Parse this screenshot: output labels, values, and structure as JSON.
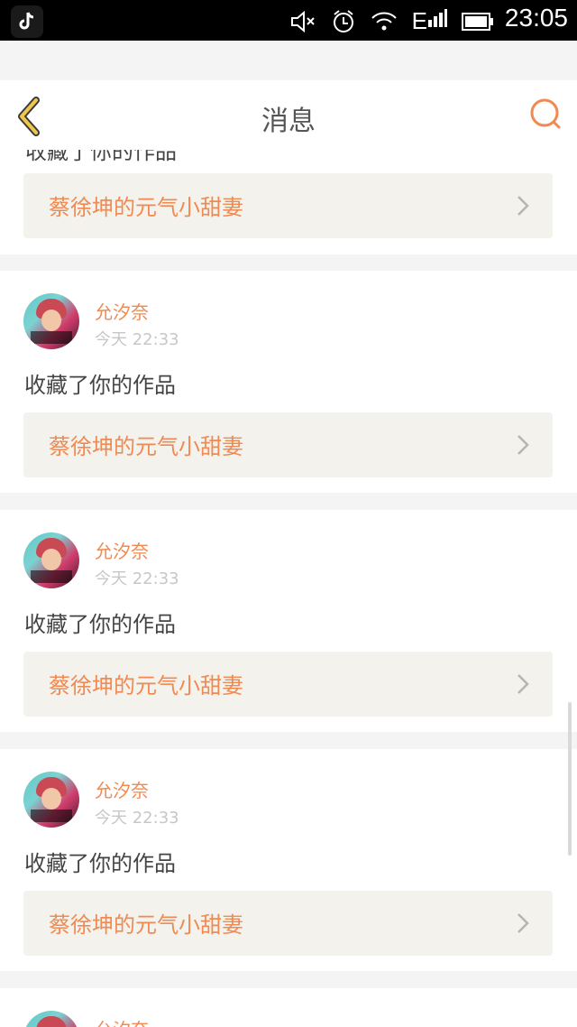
{
  "status_bar": {
    "time": "23:05",
    "network": "E"
  },
  "nav": {
    "title": "消息"
  },
  "partial_top": {
    "action_text_partial": "收藏了你的作品",
    "work_title": "蔡徐坤的元气小甜妻"
  },
  "notifications": [
    {
      "username": "允汐奈",
      "time": "今天 22:33",
      "action": "收藏了你的作品",
      "work_title": "蔡徐坤的元气小甜妻"
    },
    {
      "username": "允汐奈",
      "time": "今天 22:33",
      "action": "收藏了你的作品",
      "work_title": "蔡徐坤的元气小甜妻"
    },
    {
      "username": "允汐奈",
      "time": "今天 22:33",
      "action": "收藏了你的作品",
      "work_title": "蔡徐坤的元气小甜妻"
    }
  ],
  "partial_bottom": {
    "username": "允汐奈"
  },
  "colors": {
    "accent": "#f08a52",
    "back_chevron": "#f0c64c",
    "card_box": "#f3f2ec"
  }
}
